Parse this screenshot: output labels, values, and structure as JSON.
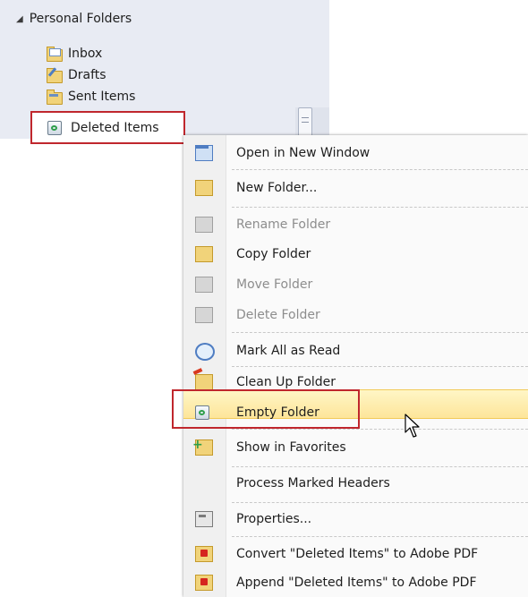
{
  "nav": {
    "root_label": "Personal Folders",
    "items": [
      {
        "label": "Inbox",
        "icon": "inbox-icon"
      },
      {
        "label": "Drafts",
        "icon": "drafts-icon"
      },
      {
        "label": "Sent Items",
        "icon": "sent-items-icon"
      }
    ],
    "selected": {
      "label": "Deleted Items",
      "icon": "deleted-items-icon"
    }
  },
  "menu": {
    "items": [
      {
        "label": "Open in New Window",
        "enabled": true,
        "icon": "new-window-icon"
      },
      {
        "label": "New Folder...",
        "enabled": true,
        "icon": "new-folder-icon"
      },
      {
        "label": "Rename Folder",
        "enabled": false,
        "icon": "rename-folder-icon"
      },
      {
        "label": "Copy Folder",
        "enabled": true,
        "icon": "copy-folder-icon"
      },
      {
        "label": "Move Folder",
        "enabled": false,
        "icon": "move-folder-icon"
      },
      {
        "label": "Delete Folder",
        "enabled": false,
        "icon": "delete-folder-icon"
      },
      {
        "label": "Mark All as Read",
        "enabled": true,
        "icon": "mark-read-icon"
      },
      {
        "label": "Clean Up Folder",
        "enabled": true,
        "icon": "clean-up-icon"
      },
      {
        "label": "Empty Folder",
        "enabled": true,
        "highlighted": true,
        "icon": "empty-folder-icon"
      },
      {
        "label": "Show in Favorites",
        "enabled": true,
        "icon": "favorites-icon"
      },
      {
        "label": "Process Marked Headers",
        "enabled": true,
        "icon": ""
      },
      {
        "label": "Properties...",
        "enabled": true,
        "icon": "properties-icon"
      },
      {
        "label": "Convert \"Deleted Items\" to Adobe PDF",
        "enabled": true,
        "icon": "pdf-convert-icon"
      },
      {
        "label": "Append \"Deleted Items\" to Adobe PDF",
        "enabled": true,
        "icon": "pdf-append-icon"
      }
    ]
  },
  "colors": {
    "highlight_outline": "#c0272d",
    "menu_hover": "#fde59a",
    "nav_background": "#e8ebf3"
  }
}
